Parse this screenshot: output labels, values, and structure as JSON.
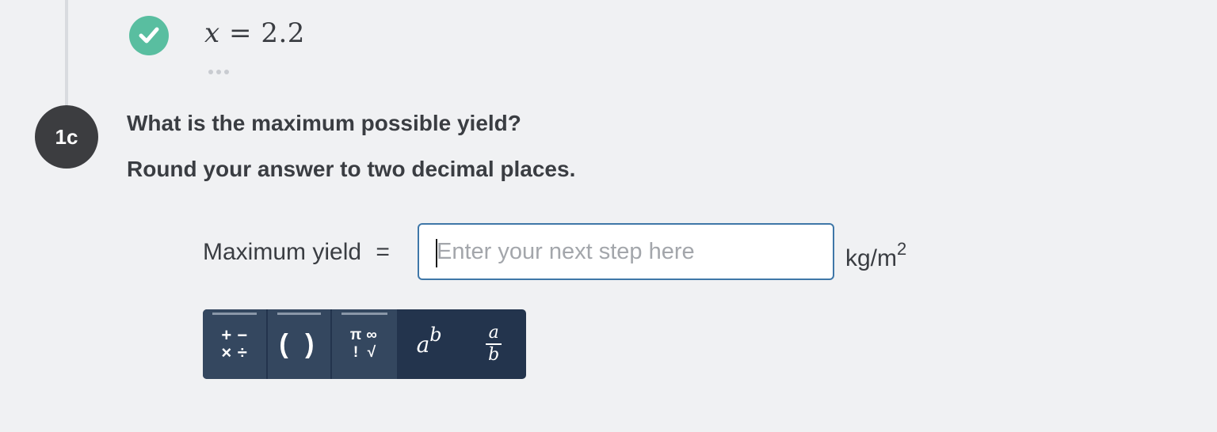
{
  "previous_step": {
    "variable": "x",
    "equals": "=",
    "value": "2.2"
  },
  "step": {
    "badge": "1c",
    "question": "What is the maximum possible yield?",
    "instruction": "Round your answer to two decimal places."
  },
  "answer": {
    "label": "Maximum yield",
    "equals": "=",
    "placeholder": "Enter your next step here",
    "value": "",
    "unit": "kg/m",
    "unit_exponent": "2"
  },
  "toolbar": {
    "operators": [
      "+",
      "−",
      "×",
      "÷"
    ],
    "parentheses": "( )",
    "symbols": [
      "π",
      "∞",
      "!",
      "√"
    ],
    "power_base": "a",
    "power_exponent": "b",
    "fraction_numerator": "a",
    "fraction_denominator": "b"
  },
  "colors": {
    "background": "#f0f1f3",
    "check": "#59bea0",
    "step_badge": "#3c3d40",
    "input_border": "#3f77a8",
    "toolbar": "#23344d",
    "toolbar_tab": "#34475f"
  }
}
